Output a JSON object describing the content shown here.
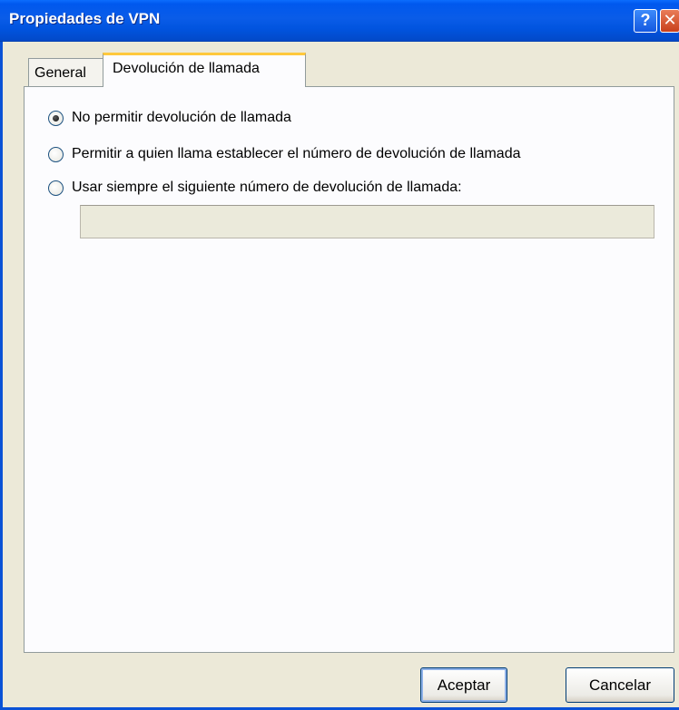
{
  "window": {
    "title": "Propiedades de VPN",
    "help_glyph": "?",
    "close_glyph": "✕"
  },
  "tabs": [
    {
      "label": "General",
      "selected": false
    },
    {
      "label": "Devolución de llamada",
      "selected": true
    }
  ],
  "callback": {
    "options": [
      {
        "label": "No permitir devolución de llamada",
        "checked": true
      },
      {
        "label": "Permitir a quien llama establecer el número de devolución de llamada",
        "checked": false
      },
      {
        "label": "Usar siempre el siguiente número de devolución de llamada:",
        "checked": false
      }
    ],
    "number_value": ""
  },
  "buttons": {
    "ok_label": "Aceptar",
    "cancel_label": "Cancelar"
  }
}
